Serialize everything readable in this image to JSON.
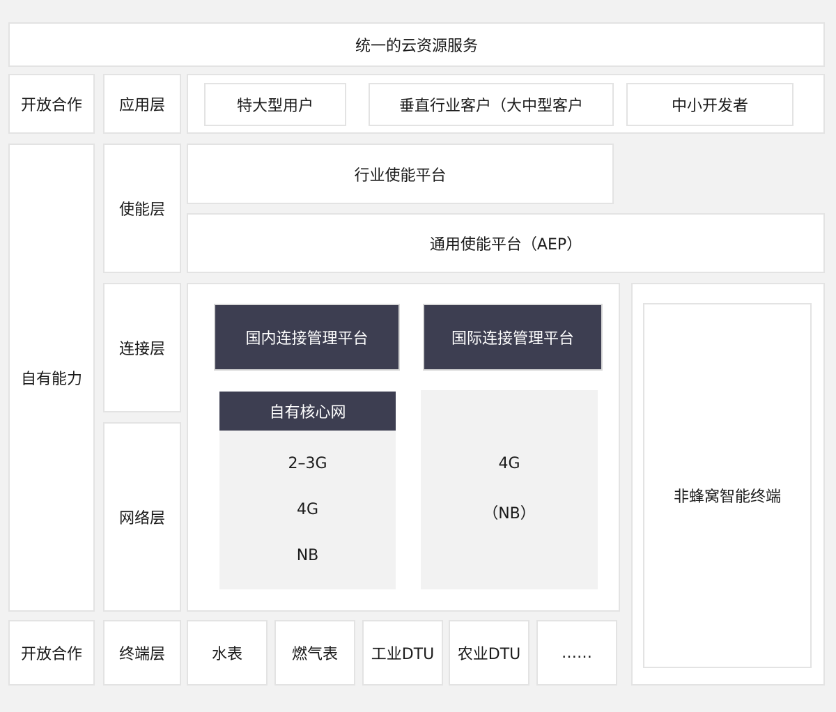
{
  "top_bar": "统一的云资源服务",
  "rows": {
    "open_top": "开放合作",
    "own": "自有能力",
    "open_bottom": "开放合作"
  },
  "layers": {
    "application": "应用层",
    "enablement": "使能层",
    "connection": "连接层",
    "network": "网络层",
    "terminal": "终端层"
  },
  "application": {
    "items": [
      "特大型用户",
      "垂直行业客户（大中型客户",
      "中小开发者"
    ]
  },
  "enablement": {
    "industry_platform": "行业使能平台",
    "general_platform": "通用使能平台（AEP）"
  },
  "connection": {
    "domestic": "国内连接管理平台",
    "international": "国际连接管理平台"
  },
  "network": {
    "core_title": "自有核心网",
    "core_items": [
      "2–3G",
      "4G",
      "NB"
    ],
    "intl_items": [
      "4G",
      "（NB）"
    ]
  },
  "non_cellular": "非蜂窝智能终端",
  "terminal": {
    "items": [
      "水表",
      "燃气表",
      "工业DTU",
      "农业DTU",
      "……"
    ]
  },
  "colors": {
    "background": "#f2f2f2",
    "panel": "#ffffff",
    "border": "#e3e3e3",
    "dark_block": "#3d3e51"
  }
}
